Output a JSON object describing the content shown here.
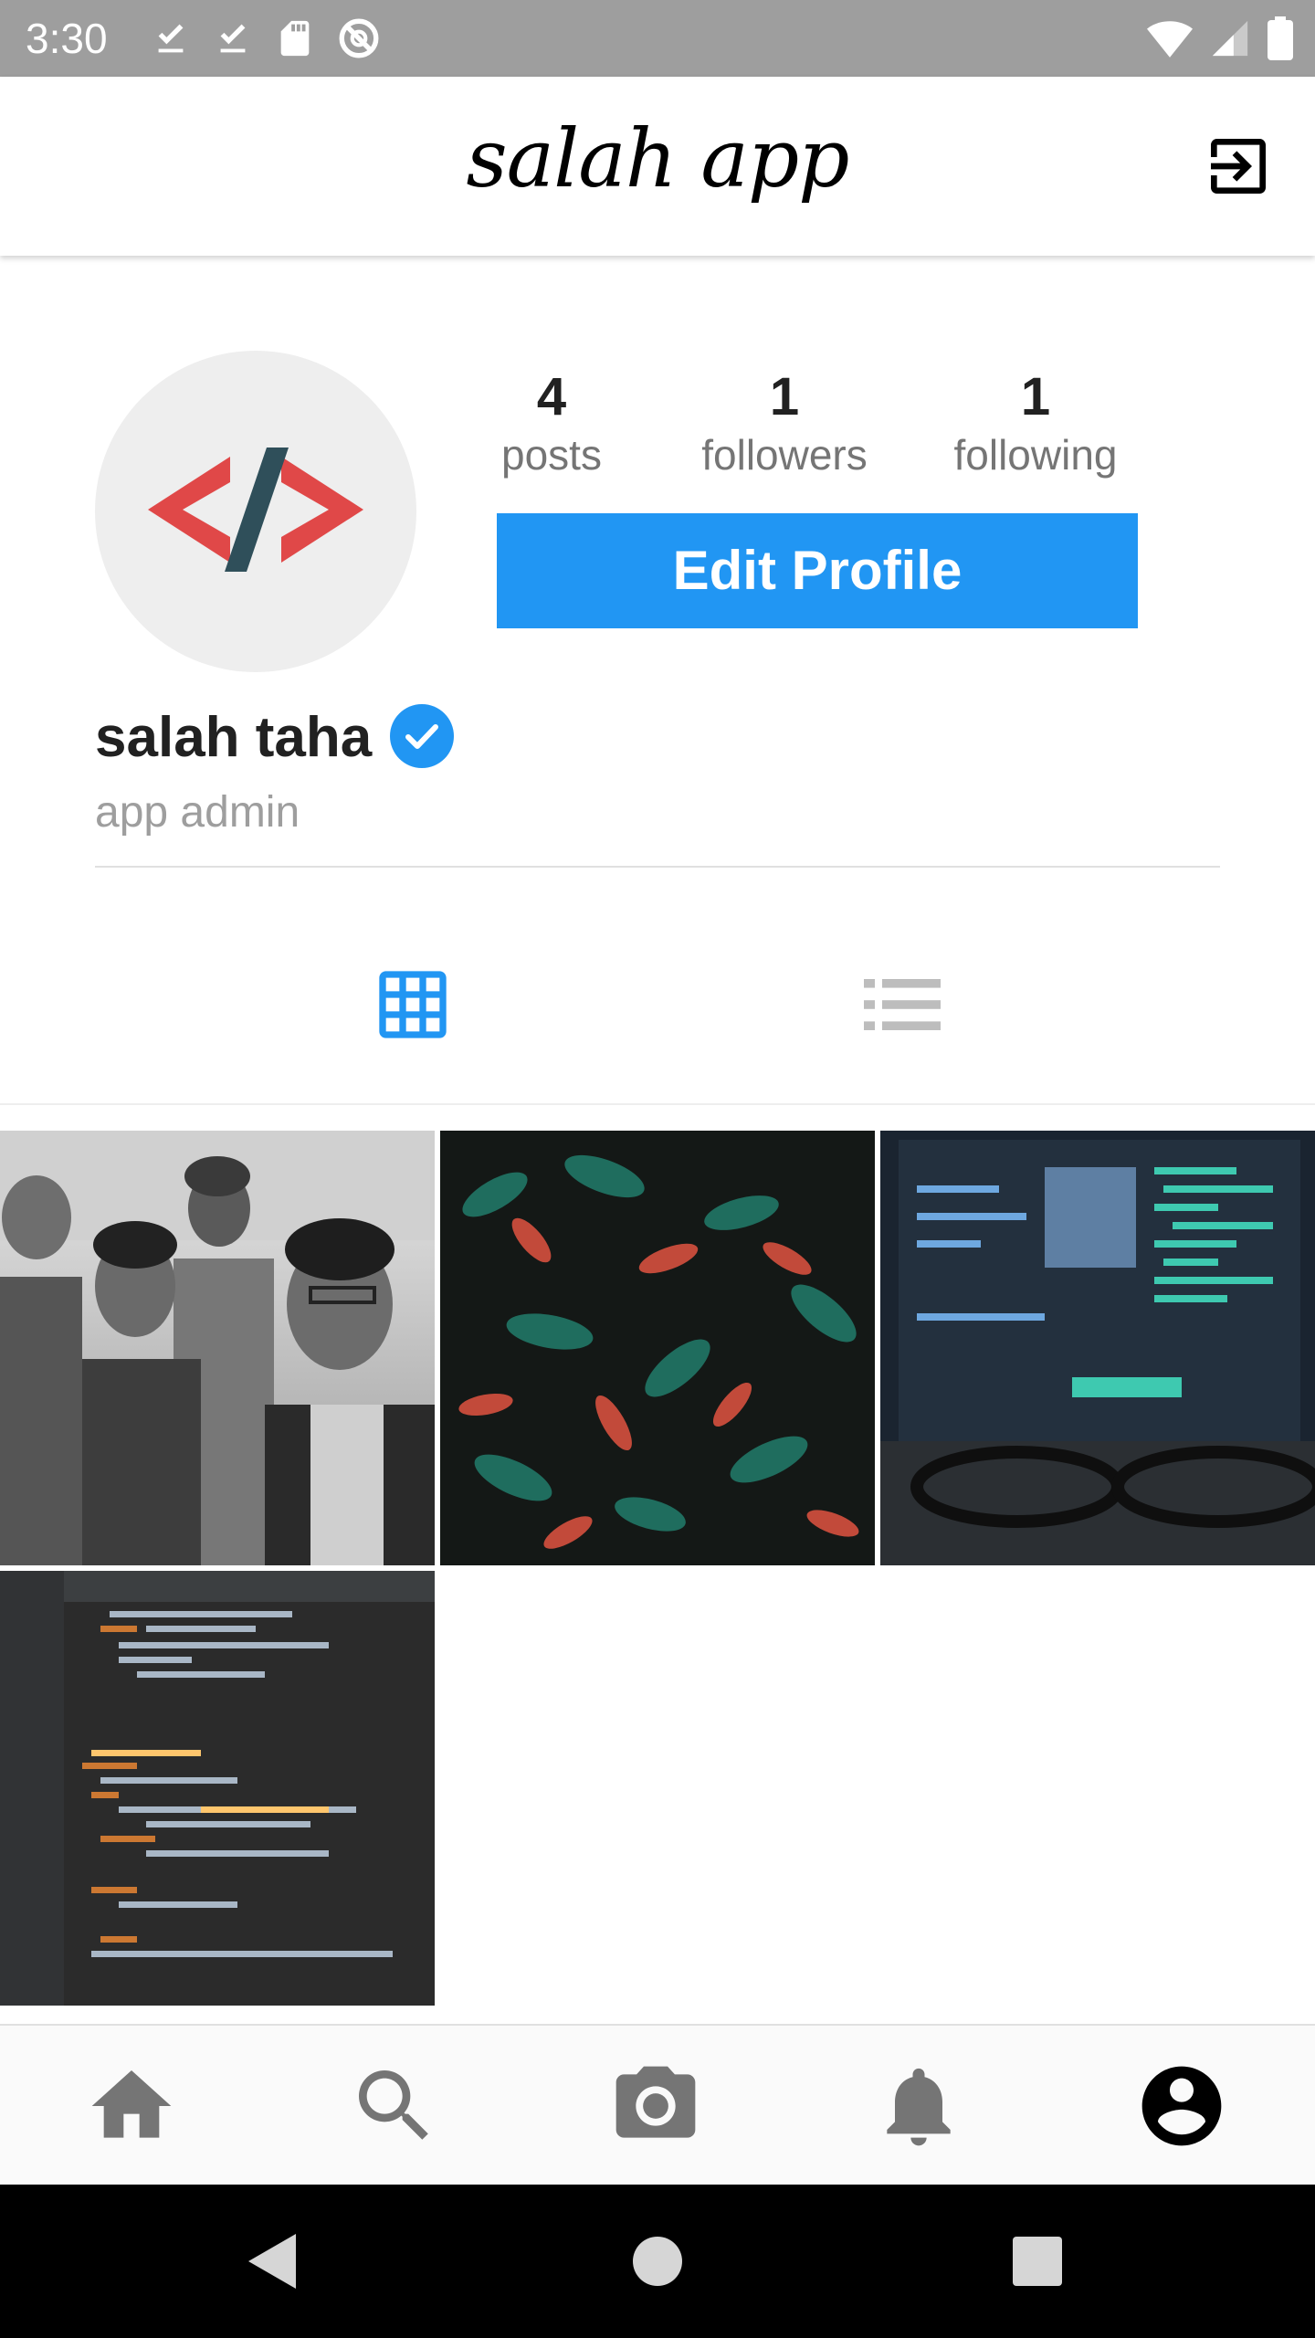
{
  "status_bar": {
    "time": "3:30",
    "icons_left": [
      "download-done-icon",
      "download-done-icon",
      "sd-card-icon",
      "blocked-sync-icon"
    ],
    "icons_right": [
      "wifi-icon",
      "cell-signal-icon",
      "battery-icon"
    ],
    "background": "#9e9e9e"
  },
  "app_bar": {
    "title": "salah app",
    "action_icon": "logout-icon"
  },
  "profile": {
    "avatar_icon": "code-brackets-icon",
    "stats": {
      "posts": {
        "count": "4",
        "label": "posts"
      },
      "followers": {
        "count": "1",
        "label": "followers"
      },
      "following": {
        "count": "1",
        "label": "following"
      }
    },
    "edit_button_label": "Edit Profile",
    "name": "salah taha",
    "verified": true,
    "bio": "app admin"
  },
  "tabs": [
    {
      "icon": "grid-icon",
      "active": true
    },
    {
      "icon": "list-icon",
      "active": false
    }
  ],
  "posts": [
    {
      "description": "group-selfie-photo"
    },
    {
      "description": "red-green-plant-photo"
    },
    {
      "description": "computer-screen-code-photo"
    },
    {
      "description": "code-editor-screenshot-photo"
    }
  ],
  "bottom_nav": [
    {
      "icon": "home-icon",
      "active": false
    },
    {
      "icon": "search-icon",
      "active": false
    },
    {
      "icon": "camera-icon",
      "active": false
    },
    {
      "icon": "notifications-icon",
      "active": false
    },
    {
      "icon": "account-circle-icon",
      "active": true
    }
  ],
  "system_nav": [
    "back-icon",
    "home-circle-icon",
    "recents-icon"
  ],
  "colors": {
    "accent": "#2196f3",
    "inactive_icon": "#757575",
    "active_icon": "#000000"
  }
}
